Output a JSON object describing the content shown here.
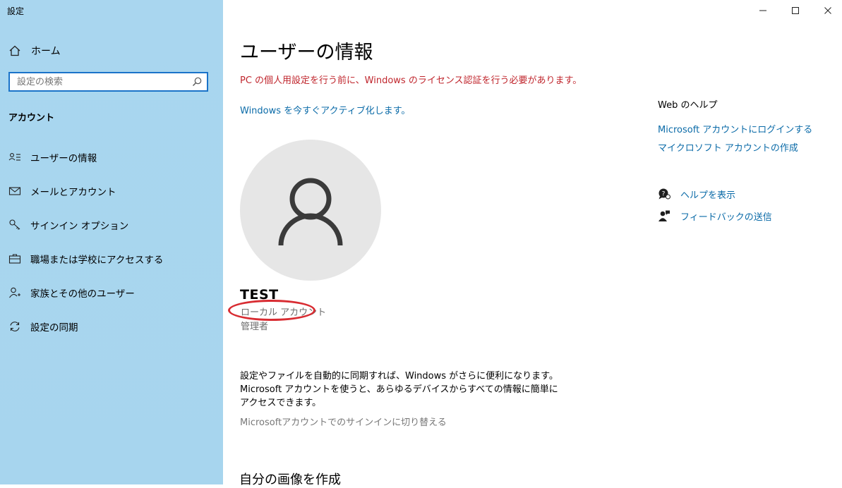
{
  "window": {
    "title": "設定",
    "controls": {
      "minimize": "—",
      "maximize": "☐",
      "close": "✕"
    }
  },
  "sidebar": {
    "home_label": "ホーム",
    "search_placeholder": "設定の検索",
    "section_title": "アカウント",
    "items": [
      {
        "label": "ユーザーの情報",
        "icon": "user-info-icon"
      },
      {
        "label": "メールとアカウント",
        "icon": "mail-icon"
      },
      {
        "label": "サインイン オプション",
        "icon": "key-icon"
      },
      {
        "label": "職場または学校にアクセスする",
        "icon": "briefcase-icon"
      },
      {
        "label": "家族とその他のユーザー",
        "icon": "person-add-icon"
      },
      {
        "label": "設定の同期",
        "icon": "sync-icon"
      }
    ]
  },
  "main": {
    "title": "ユーザーの情報",
    "warning": "PC の個人用設定を行う前に、Windows のライセンス認証を行う必要があります。",
    "activate_link": "Windows を今すぐアクティブ化します。",
    "user": {
      "name": "TEST",
      "account_type": "ローカル アカウント",
      "role": "管理者"
    },
    "sync_text": "設定やファイルを自動的に同期すれば、Windows がさらに便利になります。Microsoft アカウントを使うと、あらゆるデバイスからすべての情報に簡単にアクセスできます。",
    "switch_link": "Microsoftアカウントでのサインインに切り替える",
    "create_picture_title": "自分の画像を作成"
  },
  "help_panel": {
    "title": "Web のヘルプ",
    "links": [
      "Microsoft アカウントにログインする",
      "マイクロソフト アカウントの作成"
    ],
    "show_help": "ヘルプを表示",
    "feedback": "フィードバックの送信"
  },
  "colors": {
    "sidebar_bg": "#a9d6ef",
    "link": "#0b6ba8",
    "warning": "#c0262d",
    "annotation_oval": "#d82c32"
  }
}
